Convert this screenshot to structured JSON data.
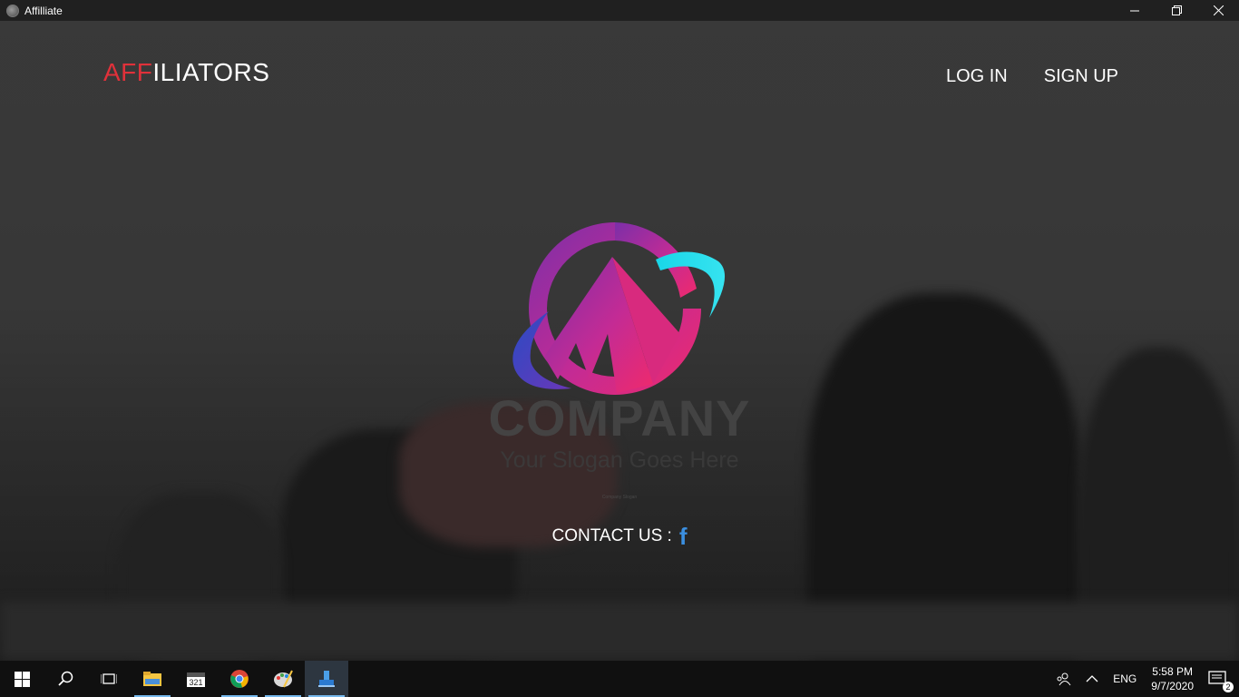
{
  "window": {
    "title": "Affilliate",
    "controls": {
      "minimize": "—",
      "restore": "❐",
      "close": "✕"
    }
  },
  "header": {
    "brand_accent": "AFF",
    "brand_rest": "ILIATORS",
    "nav": {
      "login": "LOG IN",
      "signup": "SIGN UP"
    }
  },
  "logo": {
    "company": "COMPANY",
    "slogan": "Your Slogan Goes Here",
    "tagline": "Company Slogan"
  },
  "contact": {
    "label": "CONTACT US :",
    "facebook_glyph": "f",
    "facebook_icon": "facebook-icon"
  },
  "taskbar": {
    "apps": [
      "windows-start",
      "search",
      "task-view",
      "file-explorer",
      "calendar-321",
      "chrome",
      "paint",
      "affiliate-app"
    ],
    "tray": {
      "language": "ENG",
      "time": "5:58 PM",
      "date": "9/7/2020",
      "notifications": "2"
    }
  },
  "colors": {
    "accent_red": "#e0313a",
    "facebook_blue": "#3b8fe0",
    "taskbar": "#101010",
    "titlebar": "#202020"
  }
}
